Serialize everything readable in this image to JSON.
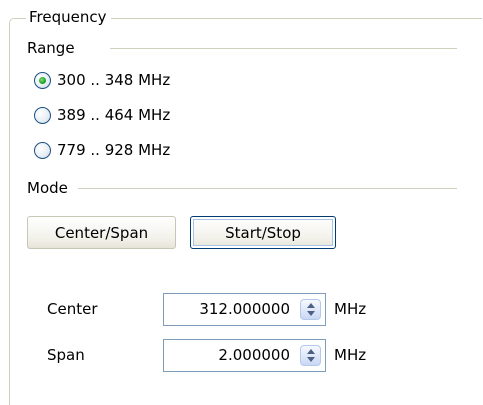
{
  "frequency": {
    "group_title": "Frequency",
    "range": {
      "label": "Range",
      "options": [
        {
          "label": "300 .. 348 MHz",
          "checked": true
        },
        {
          "label": "389 .. 464 MHz",
          "checked": false
        },
        {
          "label": "779 .. 928 MHz",
          "checked": false
        }
      ]
    },
    "mode": {
      "label": "Mode",
      "buttons": [
        {
          "label": "Center/Span",
          "active": false
        },
        {
          "label": "Start/Stop",
          "active": true
        }
      ]
    },
    "fields": [
      {
        "label": "Center",
        "value": "312.000000",
        "unit": "MHz"
      },
      {
        "label": "Span",
        "value": "2.000000",
        "unit": "MHz"
      }
    ]
  },
  "colors": {
    "group_border": "#d0d0bf",
    "radio_border": "#1c5180",
    "radio_dot": "#21a121",
    "input_border": "#7f9db9",
    "active_button_border": "#003c74"
  }
}
